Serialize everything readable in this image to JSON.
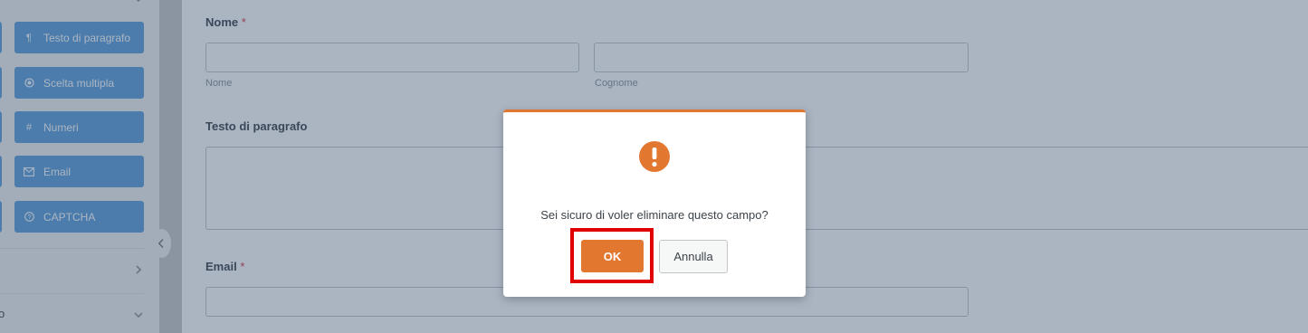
{
  "sidebar": {
    "field_buttons": [
      {
        "label": "Testo di paragrafo",
        "icon": "paragraph-icon"
      },
      {
        "label": "Scelta multipla",
        "icon": "radio-icon"
      },
      {
        "label": "Numeri",
        "icon": "hash-icon"
      },
      {
        "label": "Email",
        "icon": "envelope-icon"
      },
      {
        "label": "CAPTCHA",
        "icon": "question-circle-icon"
      }
    ],
    "partial_section_label": "o"
  },
  "form": {
    "name_field": {
      "label": "Nome",
      "required_mark": "*",
      "first_sublabel": "Nome",
      "last_sublabel": "Cognome"
    },
    "paragraph_field": {
      "label": "Testo di paragrafo"
    },
    "email_field": {
      "label": "Email",
      "required_mark": "*"
    }
  },
  "dialog": {
    "icon": "exclamation-circle-icon",
    "message": "Sei sicuro di voler eliminare questo campo?",
    "ok_label": "OK",
    "cancel_label": "Annulla"
  },
  "colors": {
    "accent": "#e27730",
    "field_button": "#5b9dd9",
    "highlight": "#e00000"
  }
}
